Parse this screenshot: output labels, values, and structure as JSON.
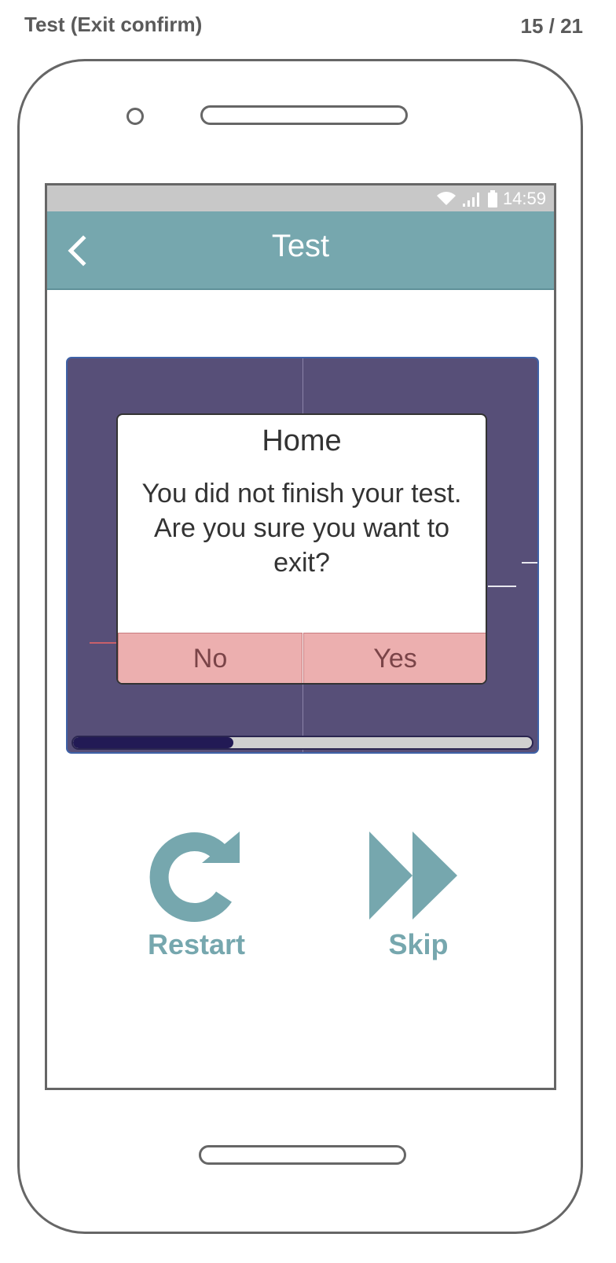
{
  "header": {
    "title": "Test (Exit confirm)",
    "page_counter": "15 / 21"
  },
  "status_bar": {
    "time": "14:59"
  },
  "app_bar": {
    "title": "Test"
  },
  "dialog": {
    "title": "Home",
    "message": "You did not finish your test. Are you sure you want to exit?",
    "no_label": "No",
    "yes_label": "Yes"
  },
  "progress": {
    "fraction": 0.35
  },
  "actions": {
    "restart_label": "Restart",
    "skip_label": "Skip"
  },
  "colors": {
    "accent": "#76a7ae",
    "panel": "#574f78",
    "dialog_button": "#ecafaf",
    "progress_fill": "#221a55"
  },
  "icons": [
    "back-icon",
    "wifi-icon",
    "signal-icon",
    "battery-icon",
    "restart-icon",
    "skip-icon"
  ]
}
